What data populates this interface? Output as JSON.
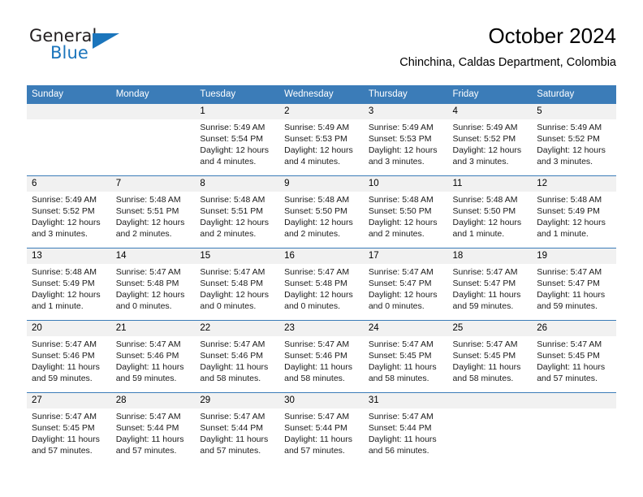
{
  "brand": {
    "name_top": "General",
    "name_bottom": "Blue",
    "color_primary": "#1b75bc",
    "color_text": "#231f20"
  },
  "header": {
    "title": "October 2024",
    "subtitle": "Chinchina, Caldas Department, Colombia"
  },
  "calendar": {
    "header_bg": "#3b7cb8",
    "daynum_bg": "#f1f1f1",
    "weekday_headers": [
      "Sunday",
      "Monday",
      "Tuesday",
      "Wednesday",
      "Thursday",
      "Friday",
      "Saturday"
    ],
    "weeks": [
      [
        {
          "day": "",
          "lines": []
        },
        {
          "day": "",
          "lines": []
        },
        {
          "day": "1",
          "lines": [
            "Sunrise: 5:49 AM",
            "Sunset: 5:54 PM",
            "Daylight: 12 hours",
            "and 4 minutes."
          ]
        },
        {
          "day": "2",
          "lines": [
            "Sunrise: 5:49 AM",
            "Sunset: 5:53 PM",
            "Daylight: 12 hours",
            "and 4 minutes."
          ]
        },
        {
          "day": "3",
          "lines": [
            "Sunrise: 5:49 AM",
            "Sunset: 5:53 PM",
            "Daylight: 12 hours",
            "and 3 minutes."
          ]
        },
        {
          "day": "4",
          "lines": [
            "Sunrise: 5:49 AM",
            "Sunset: 5:52 PM",
            "Daylight: 12 hours",
            "and 3 minutes."
          ]
        },
        {
          "day": "5",
          "lines": [
            "Sunrise: 5:49 AM",
            "Sunset: 5:52 PM",
            "Daylight: 12 hours",
            "and 3 minutes."
          ]
        }
      ],
      [
        {
          "day": "6",
          "lines": [
            "Sunrise: 5:49 AM",
            "Sunset: 5:52 PM",
            "Daylight: 12 hours",
            "and 3 minutes."
          ]
        },
        {
          "day": "7",
          "lines": [
            "Sunrise: 5:48 AM",
            "Sunset: 5:51 PM",
            "Daylight: 12 hours",
            "and 2 minutes."
          ]
        },
        {
          "day": "8",
          "lines": [
            "Sunrise: 5:48 AM",
            "Sunset: 5:51 PM",
            "Daylight: 12 hours",
            "and 2 minutes."
          ]
        },
        {
          "day": "9",
          "lines": [
            "Sunrise: 5:48 AM",
            "Sunset: 5:50 PM",
            "Daylight: 12 hours",
            "and 2 minutes."
          ]
        },
        {
          "day": "10",
          "lines": [
            "Sunrise: 5:48 AM",
            "Sunset: 5:50 PM",
            "Daylight: 12 hours",
            "and 2 minutes."
          ]
        },
        {
          "day": "11",
          "lines": [
            "Sunrise: 5:48 AM",
            "Sunset: 5:50 PM",
            "Daylight: 12 hours",
            "and 1 minute."
          ]
        },
        {
          "day": "12",
          "lines": [
            "Sunrise: 5:48 AM",
            "Sunset: 5:49 PM",
            "Daylight: 12 hours",
            "and 1 minute."
          ]
        }
      ],
      [
        {
          "day": "13",
          "lines": [
            "Sunrise: 5:48 AM",
            "Sunset: 5:49 PM",
            "Daylight: 12 hours",
            "and 1 minute."
          ]
        },
        {
          "day": "14",
          "lines": [
            "Sunrise: 5:47 AM",
            "Sunset: 5:48 PM",
            "Daylight: 12 hours",
            "and 0 minutes."
          ]
        },
        {
          "day": "15",
          "lines": [
            "Sunrise: 5:47 AM",
            "Sunset: 5:48 PM",
            "Daylight: 12 hours",
            "and 0 minutes."
          ]
        },
        {
          "day": "16",
          "lines": [
            "Sunrise: 5:47 AM",
            "Sunset: 5:48 PM",
            "Daylight: 12 hours",
            "and 0 minutes."
          ]
        },
        {
          "day": "17",
          "lines": [
            "Sunrise: 5:47 AM",
            "Sunset: 5:47 PM",
            "Daylight: 12 hours",
            "and 0 minutes."
          ]
        },
        {
          "day": "18",
          "lines": [
            "Sunrise: 5:47 AM",
            "Sunset: 5:47 PM",
            "Daylight: 11 hours",
            "and 59 minutes."
          ]
        },
        {
          "day": "19",
          "lines": [
            "Sunrise: 5:47 AM",
            "Sunset: 5:47 PM",
            "Daylight: 11 hours",
            "and 59 minutes."
          ]
        }
      ],
      [
        {
          "day": "20",
          "lines": [
            "Sunrise: 5:47 AM",
            "Sunset: 5:46 PM",
            "Daylight: 11 hours",
            "and 59 minutes."
          ]
        },
        {
          "day": "21",
          "lines": [
            "Sunrise: 5:47 AM",
            "Sunset: 5:46 PM",
            "Daylight: 11 hours",
            "and 59 minutes."
          ]
        },
        {
          "day": "22",
          "lines": [
            "Sunrise: 5:47 AM",
            "Sunset: 5:46 PM",
            "Daylight: 11 hours",
            "and 58 minutes."
          ]
        },
        {
          "day": "23",
          "lines": [
            "Sunrise: 5:47 AM",
            "Sunset: 5:46 PM",
            "Daylight: 11 hours",
            "and 58 minutes."
          ]
        },
        {
          "day": "24",
          "lines": [
            "Sunrise: 5:47 AM",
            "Sunset: 5:45 PM",
            "Daylight: 11 hours",
            "and 58 minutes."
          ]
        },
        {
          "day": "25",
          "lines": [
            "Sunrise: 5:47 AM",
            "Sunset: 5:45 PM",
            "Daylight: 11 hours",
            "and 58 minutes."
          ]
        },
        {
          "day": "26",
          "lines": [
            "Sunrise: 5:47 AM",
            "Sunset: 5:45 PM",
            "Daylight: 11 hours",
            "and 57 minutes."
          ]
        }
      ],
      [
        {
          "day": "27",
          "lines": [
            "Sunrise: 5:47 AM",
            "Sunset: 5:45 PM",
            "Daylight: 11 hours",
            "and 57 minutes."
          ]
        },
        {
          "day": "28",
          "lines": [
            "Sunrise: 5:47 AM",
            "Sunset: 5:44 PM",
            "Daylight: 11 hours",
            "and 57 minutes."
          ]
        },
        {
          "day": "29",
          "lines": [
            "Sunrise: 5:47 AM",
            "Sunset: 5:44 PM",
            "Daylight: 11 hours",
            "and 57 minutes."
          ]
        },
        {
          "day": "30",
          "lines": [
            "Sunrise: 5:47 AM",
            "Sunset: 5:44 PM",
            "Daylight: 11 hours",
            "and 57 minutes."
          ]
        },
        {
          "day": "31",
          "lines": [
            "Sunrise: 5:47 AM",
            "Sunset: 5:44 PM",
            "Daylight: 11 hours",
            "and 56 minutes."
          ]
        },
        {
          "day": "",
          "lines": []
        },
        {
          "day": "",
          "lines": []
        }
      ]
    ]
  }
}
